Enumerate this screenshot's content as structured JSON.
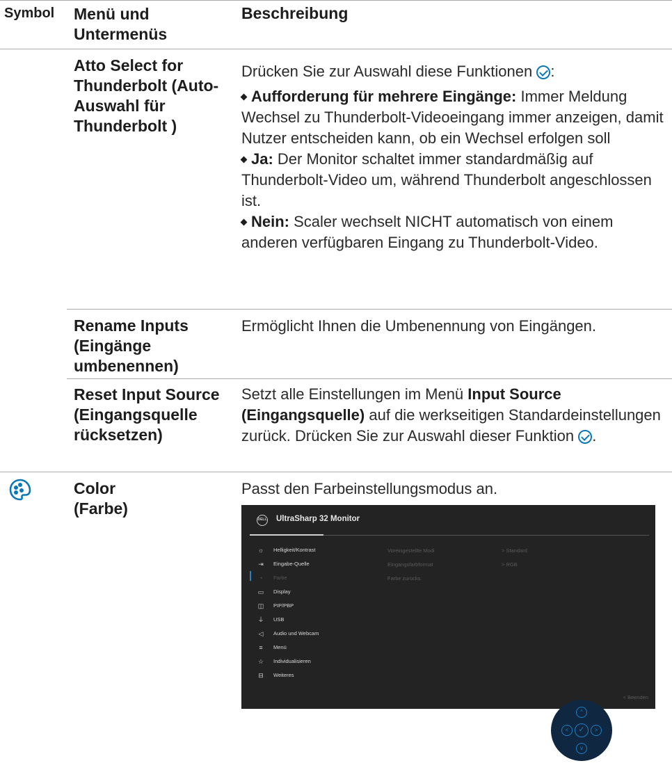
{
  "header": {
    "col_symbol": "Symbol",
    "col_menu": "Menü und Untermenüs",
    "col_desc": "Beschreibung"
  },
  "rows": [
    {
      "menu": "Atto Select for Thunderbolt (Auto-Auswahl für Thunderbolt )",
      "intro": "Drücken Sie zur Auswahl diese Funktionen",
      "intro_end": ":",
      "b1_title": "Aufforderung für mehrere Eingänge:",
      "b1_text": "Immer Meldung Wechsel zu Thunderbolt-Videoeingang immer anzeigen, damit Nutzer entscheiden kann, ob ein Wechsel erfolgen soll",
      "b2_title": "Ja:",
      "b2_text": "Der Monitor schaltet immer standardmäßig auf Thunderbolt-Video um, während Thunderbolt angeschlossen ist.",
      "b3_title": "Nein:",
      "b3_text": "Scaler wechselt NICHT automatisch von einem anderen verfügbaren Eingang zu Thunderbolt-Video."
    },
    {
      "menu": "Rename Inputs (Eingänge umbenennen)",
      "desc": "Ermöglicht Ihnen die Umbenennung von Eingängen."
    },
    {
      "menu": "Reset Input Source (Eingangsquelle rücksetzen)",
      "desc_a": "Setzt alle Einstellungen im Menü",
      "desc_bold": "Input Source (Eingangsquelle)",
      "desc_b": "auf die werkseitigen Standardeinstellungen zurück. Drücken Sie zur Auswahl dieser Funktion",
      "desc_end": "."
    },
    {
      "menu_line1": "Color",
      "menu_line2": "(Farbe)",
      "desc": "Passt den Farbeinstellungsmodus an.",
      "icon": "color-palette-icon"
    }
  ],
  "osd": {
    "logo": "DELL",
    "title": "UltraSharp 32 Monitor",
    "menu": [
      {
        "label": "Helligkeit/Kontrast",
        "icon": "brightness-icon"
      },
      {
        "label": "Eingabe-Quelle",
        "icon": "input-source-icon"
      },
      {
        "label": "Farbe",
        "icon": "color-icon"
      },
      {
        "label": "Display",
        "icon": "display-icon"
      },
      {
        "label": "PIP/PBP",
        "icon": "pip-pbp-icon"
      },
      {
        "label": "USB",
        "icon": "usb-icon"
      },
      {
        "label": "Audio und Webcam",
        "icon": "audio-webcam-icon"
      },
      {
        "label": "Menü",
        "icon": "menu-icon"
      },
      {
        "label": "Individualisieren",
        "icon": "star-icon"
      },
      {
        "label": "Weiteres",
        "icon": "others-icon"
      }
    ],
    "sub": [
      {
        "label": "Voreingestellte Modi",
        "value": "> Standard"
      },
      {
        "label": "Eingangsfarbformat",
        "value": "> RGB"
      },
      {
        "label": "Farbe zurücks.",
        "value": ""
      }
    ],
    "exit": "< Beenden"
  },
  "joystick": {
    "up": "^",
    "down": "v",
    "left": "<",
    "right": ">",
    "center": "✓"
  }
}
